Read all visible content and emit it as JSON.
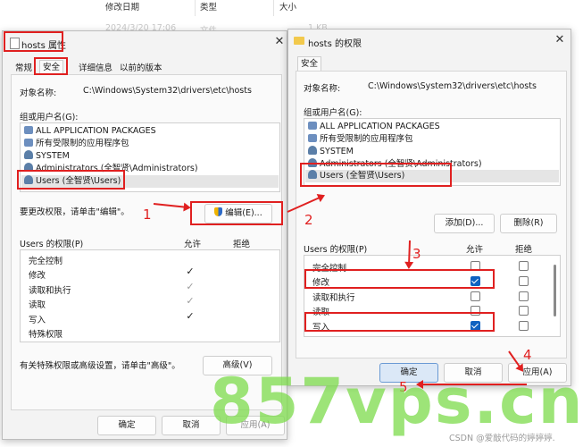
{
  "explorer": {
    "headers": [
      "修改日期",
      "类型",
      "大小"
    ],
    "row": {
      "date": "2024/3/20 17:06",
      "type": "文件",
      "size": "1 KB"
    }
  },
  "left": {
    "title": "hosts 属性",
    "tabs": [
      "常规",
      "安全",
      "详细信息",
      "以前的版本"
    ],
    "object_label": "对象名称:",
    "object_value": "C:\\Windows\\System32\\drivers\\etc\\hosts",
    "groups_label": "组或用户名(G):",
    "groups": [
      "ALL APPLICATION PACKAGES",
      "所有受限制的应用程序包",
      "SYSTEM",
      "Administrators (全智贤\\Administrators)",
      "Users (全智贤\\Users)"
    ],
    "change_hint": "要更改权限，请单击\"编辑\"。",
    "edit_button": "编辑(E)...",
    "perm_label": "Users 的权限(P)",
    "allow": "允许",
    "deny": "拒绝",
    "perms": [
      "完全控制",
      "修改",
      "读取和执行",
      "读取",
      "写入",
      "特殊权限"
    ],
    "adv_hint": "有关特殊权限或高级设置，请单击\"高级\"。",
    "adv_button": "高级(V)",
    "ok": "确定",
    "cancel": "取消",
    "apply": "应用(A)"
  },
  "right": {
    "title": "hosts 的权限",
    "tab": "安全",
    "object_label": "对象名称:",
    "object_value": "C:\\Windows\\System32\\drivers\\etc\\hosts",
    "groups_label": "组或用户名(G):",
    "groups": [
      "ALL APPLICATION PACKAGES",
      "所有受限制的应用程序包",
      "SYSTEM",
      "Administrators (全智贤\\Administrators)",
      "Users (全智贤\\Users)"
    ],
    "add_button": "添加(D)...",
    "remove_button": "删除(R)",
    "perm_label": "Users 的权限(P)",
    "allow": "允许",
    "deny": "拒绝",
    "perms": [
      "完全控制",
      "修改",
      "读取和执行",
      "读取",
      "写入"
    ],
    "ok": "确定",
    "cancel": "取消",
    "apply": "应用(A)"
  },
  "annotations": [
    "1",
    "2",
    "3",
    "4",
    "5"
  ],
  "watermark": "857vps.cn",
  "credit": "CSDN @爱敲代码的婷婷婷."
}
